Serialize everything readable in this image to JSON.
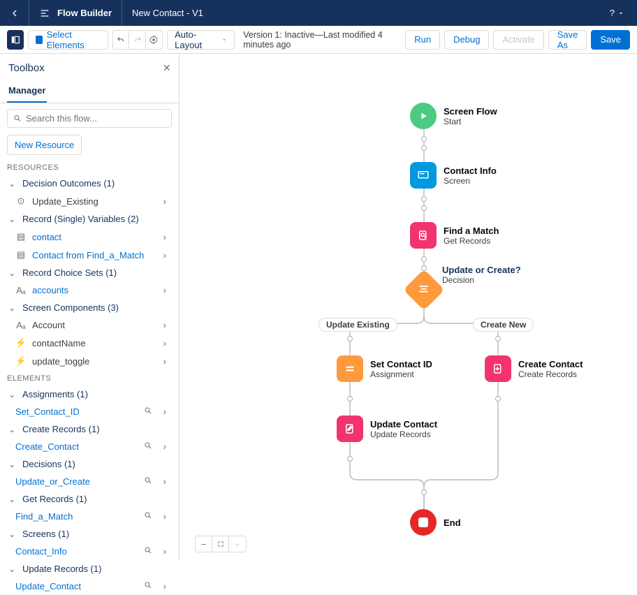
{
  "header": {
    "appTitle": "Flow Builder",
    "flowName": "New Contact - V1",
    "help": "?"
  },
  "subheader": {
    "selectElements": "Select Elements",
    "layoutMode": "Auto-Layout",
    "versionText": "Version 1: Inactive—Last modified 4 minutes ago",
    "run": "Run",
    "debug": "Debug",
    "activate": "Activate",
    "saveAs": "Save As",
    "save": "Save"
  },
  "sidebar": {
    "title": "Toolbox",
    "tab": "Manager",
    "searchPlaceholder": "Search this flow...",
    "newResource": "New Resource",
    "sections": {
      "resources": "RESOURCES",
      "elements": "ELEMENTS"
    },
    "resources": [
      {
        "label": "Decision Outcomes (1)",
        "items": [
          {
            "label": "Update_Existing",
            "link": false
          }
        ]
      },
      {
        "label": "Record (Single) Variables (2)",
        "items": [
          {
            "label": "contact",
            "link": true
          },
          {
            "label": "Contact from Find_a_Match",
            "link": true
          }
        ]
      },
      {
        "label": "Record Choice Sets (1)",
        "items": [
          {
            "label": "accounts",
            "link": true
          }
        ]
      },
      {
        "label": "Screen Components (3)",
        "items": [
          {
            "label": "Account",
            "link": false
          },
          {
            "label": "contactName",
            "link": false
          },
          {
            "label": "update_toggle",
            "link": false
          }
        ]
      }
    ],
    "elements": [
      {
        "label": "Assignments (1)",
        "items": [
          {
            "label": "Set_Contact_ID"
          }
        ]
      },
      {
        "label": "Create Records (1)",
        "items": [
          {
            "label": "Create_Contact"
          }
        ]
      },
      {
        "label": "Decisions (1)",
        "items": [
          {
            "label": "Update_or_Create"
          }
        ]
      },
      {
        "label": "Get Records (1)",
        "items": [
          {
            "label": "Find_a_Match"
          }
        ]
      },
      {
        "label": "Screens (1)",
        "items": [
          {
            "label": "Contact_Info"
          }
        ]
      },
      {
        "label": "Update Records (1)",
        "items": [
          {
            "label": "Update_Contact"
          }
        ]
      }
    ]
  },
  "canvas": {
    "nodes": {
      "start": {
        "title": "Screen Flow",
        "sub": "Start"
      },
      "screen1": {
        "title": "Contact Info",
        "sub": "Screen"
      },
      "get": {
        "title": "Find a Match",
        "sub": "Get Records"
      },
      "decision": {
        "title": "Update or Create?",
        "sub": "Decision"
      },
      "branchLeft": "Update Existing",
      "branchRight": "Create New",
      "assign": {
        "title": "Set Contact ID",
        "sub": "Assignment"
      },
      "update": {
        "title": "Update Contact",
        "sub": "Update Records"
      },
      "create": {
        "title": "Create Contact",
        "sub": "Create Records"
      },
      "end": {
        "title": "End"
      }
    }
  }
}
